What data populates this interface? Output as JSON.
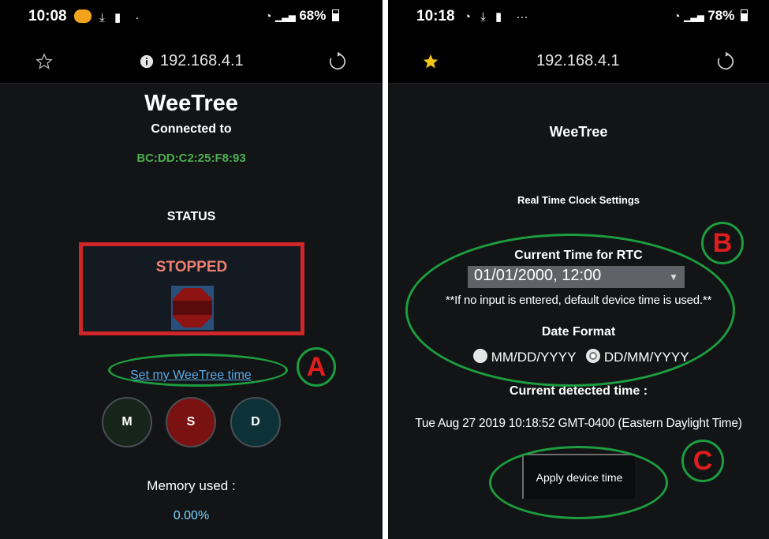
{
  "left": {
    "statusbar": {
      "time": "10:08",
      "battery_pct": "68%"
    },
    "url": "192.168.4.1",
    "app_title": "WeeTree",
    "connected_label": "Connected to",
    "mac_address": "BC:DD:C2:25:F8:93",
    "status_heading": "STATUS",
    "status_text": "STOPPED",
    "set_time_link": "Set my WeeTree time",
    "mode_buttons": [
      {
        "label": "M",
        "color": "#16241a"
      },
      {
        "label": "S",
        "color": "#7a1212"
      },
      {
        "label": "D",
        "color": "#0c3237"
      }
    ],
    "memory_label": "Memory used :",
    "memory_value": "0.00%",
    "annotation_label": "A"
  },
  "right": {
    "statusbar": {
      "time": "10:18",
      "battery_pct": "78%",
      "more": "···"
    },
    "url": "192.168.4.1",
    "app_title": "WeeTree",
    "section_title": "Real Time Clock Settings",
    "current_time_label": "Current Time for RTC",
    "datetime_value": "01/01/2000, 12:00",
    "hint": "**If no input is entered, default device time is used.**",
    "date_format_label": "Date Format",
    "format_options": [
      {
        "label": "MM/DD/YYYY",
        "selected": false
      },
      {
        "label": "DD/MM/YYYY",
        "selected": true
      }
    ],
    "detected_label": "Current detected time :",
    "detected_time": "Tue Aug 27 2019 10:18:52 GMT-0400 (Eastern Daylight Time)",
    "apply_button": "Apply device time",
    "annotation_b": "B",
    "annotation_c": "C"
  },
  "colors": {
    "background": "#121416",
    "mac_green": "#4caf50",
    "stopped_text": "#f08070",
    "status_border": "#d0262a",
    "link": "#5aa9e6",
    "memory_value": "#7fd3ff",
    "annotation_green": "#1d9d3f",
    "annotation_red": "#e11d1d",
    "star_yellow": "#f5c518"
  },
  "icons": [
    "star-outline-icon",
    "star-filled-icon",
    "info-icon",
    "reload-icon",
    "download-icon",
    "sd-card-icon",
    "wifi-icon",
    "signal-icon",
    "battery-icon",
    "stop-octagon-icon"
  ]
}
